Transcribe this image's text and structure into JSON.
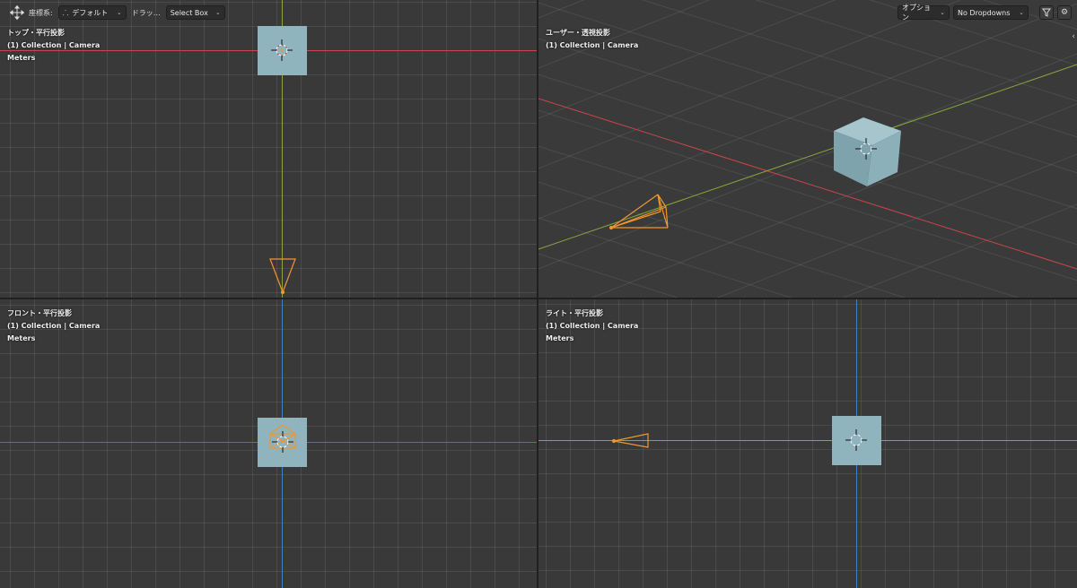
{
  "header": {
    "coord_label": "座標系:",
    "coord_value": "デフォルト",
    "drag_label": "ドラッ…",
    "drag_value": "Select Box",
    "options_label": "オプション",
    "dropdowns_value": "No Dropdowns"
  },
  "viewports": {
    "top": {
      "title": "トップ・平行投影",
      "collection": "(1) Collection | Camera",
      "units": "Meters"
    },
    "user": {
      "title": "ユーザー・透視投影",
      "collection": "(1) Collection | Camera"
    },
    "front": {
      "title": "フロント・平行投影",
      "collection": "(1) Collection | Camera",
      "units": "Meters"
    },
    "right": {
      "title": "ライト・平行投影",
      "collection": "(1) Collection | Camera",
      "units": "Meters"
    }
  },
  "colors": {
    "x_axis": "#c8464c",
    "y_axis": "#86a83a",
    "z_axis": "#3f7fcf",
    "cube": "#8fb4bd",
    "camera": "#f0962e",
    "background": "#393939"
  },
  "icons": {
    "transform_tool": "move-arrows-icon",
    "coord_system": "transform-orientation-icon",
    "filter": "filter-funnel-icon",
    "settings": "gear-icon",
    "sidebar_toggle": "chevron-left-icon"
  }
}
